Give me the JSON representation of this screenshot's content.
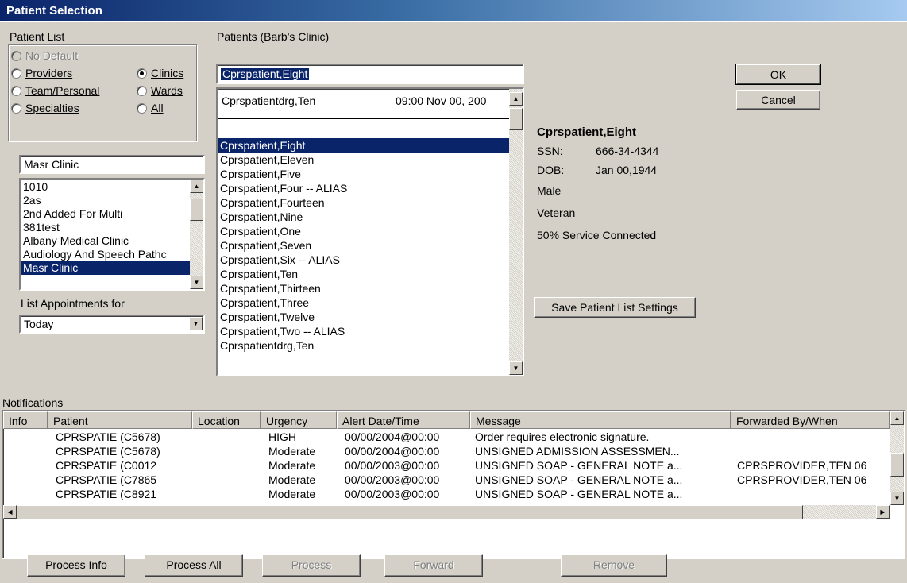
{
  "window": {
    "title": "Patient Selection"
  },
  "patient_list": {
    "label": "Patient List",
    "radios": [
      {
        "label": "No Default",
        "checked": false,
        "disabled": true
      },
      {
        "label": "Providers",
        "checked": false,
        "disabled": false
      },
      {
        "label": "Team/Personal",
        "checked": false,
        "disabled": false
      },
      {
        "label": "Specialties",
        "checked": false,
        "disabled": false
      },
      {
        "label": "Clinics",
        "checked": true,
        "disabled": false
      },
      {
        "label": "Wards",
        "checked": false,
        "disabled": false
      },
      {
        "label": "All",
        "checked": false,
        "disabled": false
      }
    ],
    "clinic_value": "Masr Clinic",
    "clinics": [
      "1010",
      "2as",
      "2nd Added For Multi",
      "381test",
      "Albany Medical Clinic",
      "Audiology And Speech Pathc",
      "Masr Clinic"
    ],
    "selected_clinic": "Masr Clinic",
    "appointments_label": "List Appointments for",
    "appointments_value": "Today"
  },
  "patients": {
    "label": "Patients (Barb's Clinic)",
    "search_value": "Cprspatient,Eight",
    "recent_name": "Cprspatientdrg,Ten",
    "recent_time": "09:00  Nov 00, 200",
    "items": [
      "Cprspatient,Eight",
      "Cprspatient,Eleven",
      "Cprspatient,Five",
      "Cprspatient,Four -- ALIAS",
      "Cprspatient,Fourteen",
      "Cprspatient,Nine",
      "Cprspatient,One",
      "Cprspatient,Seven",
      "Cprspatient,Six -- ALIAS",
      "Cprspatient,Ten",
      "Cprspatient,Thirteen",
      "Cprspatient,Three",
      "Cprspatient,Twelve",
      "Cprspatient,Two -- ALIAS",
      "Cprspatientdrg,Ten"
    ],
    "selected": "Cprspatient,Eight"
  },
  "details": {
    "name": "Cprspatient,Eight",
    "ssn_label": "SSN:",
    "ssn_value": "666-34-4344",
    "dob_label": "DOB:",
    "dob_value": "Jan 00,1944",
    "sex": "Male",
    "status": "Veteran",
    "service": "50% Service Connected"
  },
  "buttons": {
    "ok": "OK",
    "cancel": "Cancel",
    "save_settings": "Save Patient List Settings",
    "process_info": "Process Info",
    "process_all": "Process All",
    "process": "Process",
    "forward": "Forward",
    "remove": "Remove"
  },
  "notifications": {
    "label": "Notifications",
    "columns": [
      "Info",
      "Patient",
      "Location",
      "Urgency",
      "Alert Date/Time",
      "Message",
      "Forwarded By/When"
    ],
    "rows": [
      {
        "patient": "CPRSPATIE (C5678)",
        "location": "",
        "urgency": "HIGH",
        "datetime": "00/00/2004@00:00",
        "message": "Order requires electronic signature.",
        "forwarded": ""
      },
      {
        "patient": "CPRSPATIE (C5678)",
        "location": "",
        "urgency": "Moderate",
        "datetime": "00/00/2004@00:00",
        "message": "UNSIGNED ADMISSION ASSESSMEN...",
        "forwarded": ""
      },
      {
        "patient": "CPRSPATIE (C0012",
        "location": "",
        "urgency": "Moderate",
        "datetime": "00/00/2003@00:00",
        "message": "UNSIGNED SOAP - GENERAL NOTE a...",
        "forwarded": "CPRSPROVIDER,TEN   06"
      },
      {
        "patient": "CPRSPATIE (C7865",
        "location": "",
        "urgency": "Moderate",
        "datetime": "00/00/2003@00:00",
        "message": "UNSIGNED SOAP - GENERAL NOTE a...",
        "forwarded": "CPRSPROVIDER,TEN   06"
      },
      {
        "patient": "CPRSPATIE (C8921",
        "location": "",
        "urgency": "Moderate",
        "datetime": "00/00/2003@00:00",
        "message": "UNSIGNED SOAP - GENERAL NOTE a...",
        "forwarded": ""
      }
    ]
  }
}
